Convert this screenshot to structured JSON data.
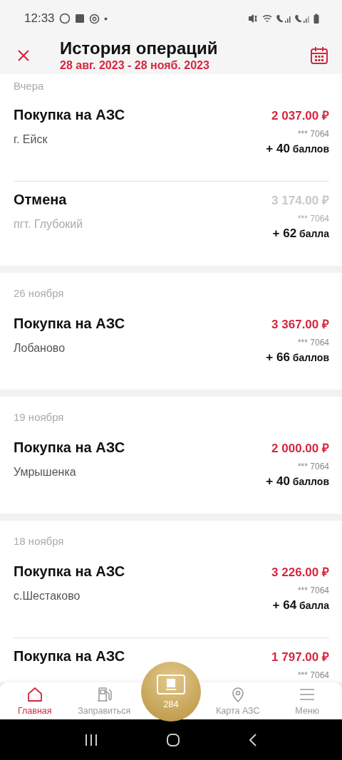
{
  "status_bar": {
    "time": "12:33"
  },
  "header": {
    "title": "История операций",
    "period": "28 авг. 2023 - 28 нояб. 2023"
  },
  "groups": [
    {
      "date": "Вчера",
      "operations": [
        {
          "kind": "purchase",
          "name": "Покупка на АЗС",
          "place": "г. Ейск",
          "amount": "2 037.00 ₽",
          "card": "*** 7064",
          "points": "+ 40",
          "points_unit": "баллов"
        },
        {
          "kind": "cancel",
          "name": "Отмена",
          "place": "пгт. Глубокий",
          "amount": "3 174.00 ₽",
          "card": "*** 7064",
          "points": "+ 62",
          "points_unit": "балла"
        }
      ]
    },
    {
      "date": "26 ноября",
      "operations": [
        {
          "kind": "purchase",
          "name": "Покупка на АЗС",
          "place": "Лобаново",
          "amount": "3 367.00 ₽",
          "card": "*** 7064",
          "points": "+ 66",
          "points_unit": "баллов"
        }
      ]
    },
    {
      "date": "19 ноября",
      "operations": [
        {
          "kind": "purchase",
          "name": "Покупка на АЗС",
          "place": "Умрышенка",
          "amount": "2 000.00 ₽",
          "card": "*** 7064",
          "points": "+ 40",
          "points_unit": "баллов"
        }
      ]
    },
    {
      "date": "18 ноября",
      "operations": [
        {
          "kind": "purchase",
          "name": "Покупка на АЗС",
          "place": "с.Шестаково",
          "amount": "3 226.00 ₽",
          "card": "*** 7064",
          "points": "+ 64",
          "points_unit": "балла"
        },
        {
          "kind": "purchase",
          "name": "Покупка на АЗС",
          "amount": "1 797.00 ₽",
          "card": "*** 7064"
        }
      ]
    }
  ],
  "nav": {
    "items": [
      {
        "label": "Главная",
        "selected": true,
        "kind": "home"
      },
      {
        "label": "Заправиться",
        "selected": false,
        "kind": "fuel"
      },
      {
        "label": "Карта АЗС",
        "selected": false,
        "kind": "map"
      },
      {
        "label": "Меню",
        "selected": false,
        "kind": "menu"
      }
    ],
    "card_points": "284"
  }
}
